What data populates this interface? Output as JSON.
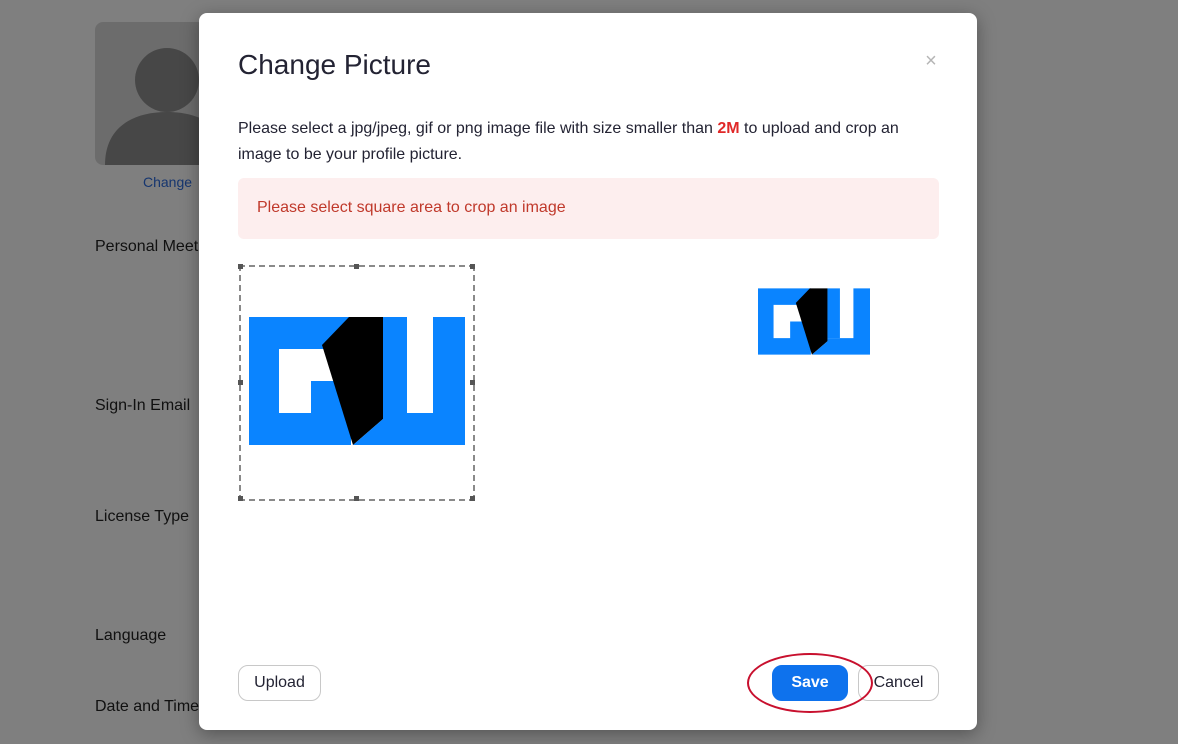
{
  "background": {
    "change_link": "Change",
    "labels": [
      "Personal Meeting ID",
      "Sign-In Email",
      "License Type",
      "Language",
      "Date and Time"
    ]
  },
  "modal": {
    "title": "Change Picture",
    "close_icon": "×",
    "description_before": "Please select a jpg/jpeg, gif or png image file with size smaller than ",
    "description_limit": "2M",
    "description_after": " to upload and crop an image to be your profile picture.",
    "alert": "Please select square area to crop an image",
    "buttons": {
      "upload": "Upload",
      "save": "Save",
      "cancel": "Cancel"
    }
  },
  "colors": {
    "accent": "#0e72ed",
    "logo_blue": "#0a84ff",
    "alert_text": "#c0392b",
    "limit_text": "#e02828",
    "highlight_ring": "#c8102e"
  },
  "icons": {
    "close": "close-icon",
    "avatar": "user-silhouette-icon",
    "logo": "gu-logo"
  }
}
